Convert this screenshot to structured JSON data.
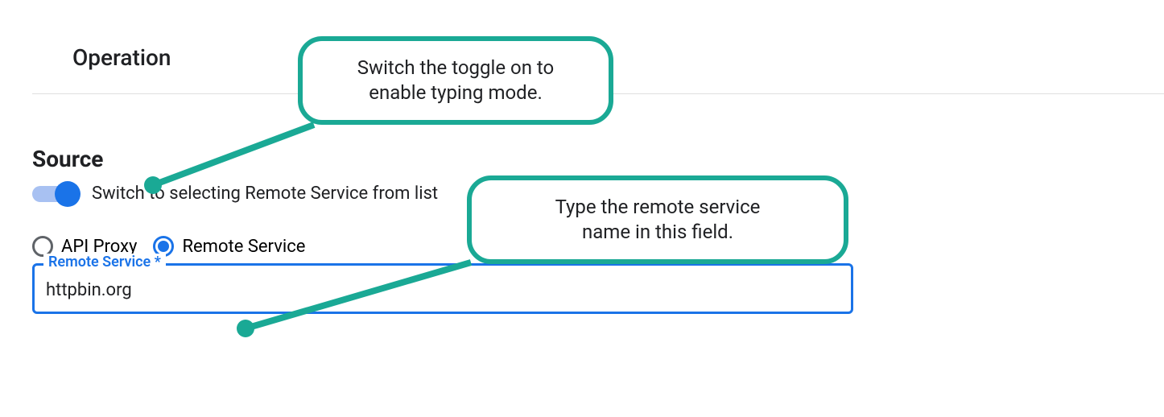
{
  "headings": {
    "operation": "Operation",
    "source": "Source"
  },
  "toggle": {
    "label": "Switch to selecting Remote Service from list"
  },
  "radio": {
    "api_proxy": "API Proxy",
    "remote_service": "Remote Service"
  },
  "field": {
    "label": "Remote Service *",
    "value": "httpbin.org"
  },
  "callouts": {
    "c1_line1": "Switch the toggle on to",
    "c1_line2": "enable typing mode.",
    "c2_line1": "Type the remote service",
    "c2_line2": "name in this field."
  }
}
